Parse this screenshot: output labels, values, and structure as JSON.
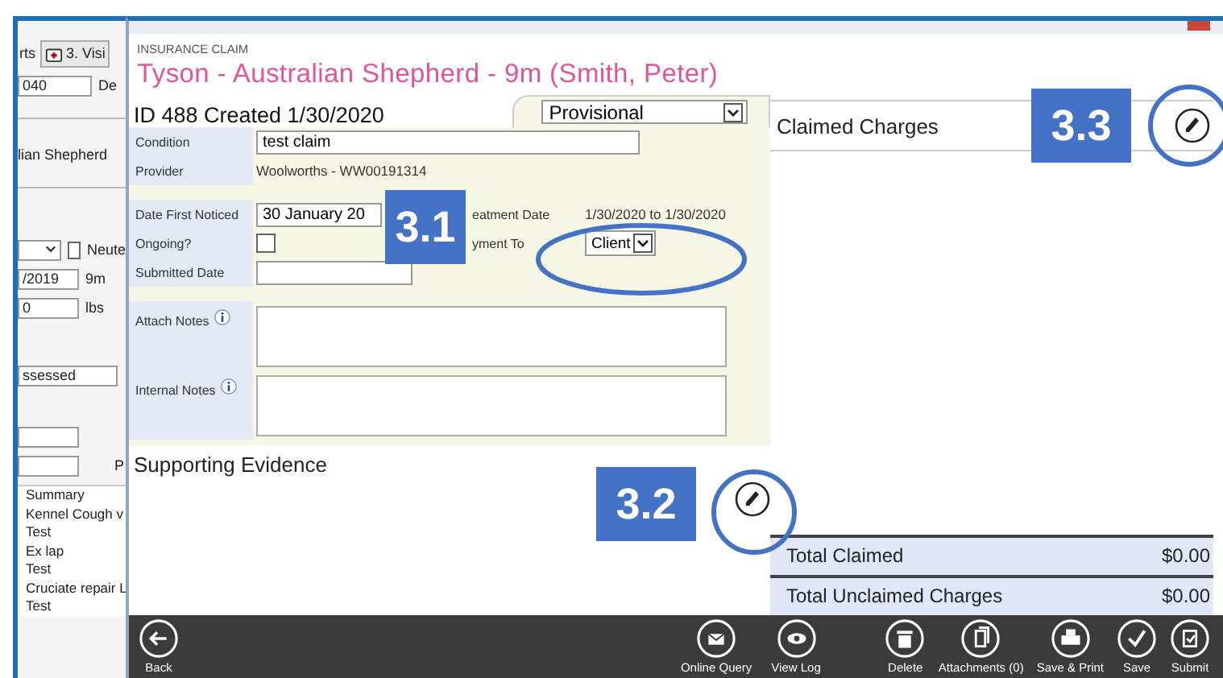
{
  "background_window": {
    "tab_fragment": "rts",
    "visits_tab": "3. Visi",
    "id_fragment": "040",
    "label_fragment": "De",
    "breed": "lian Shepherd",
    "neuter_label": "Neute",
    "neuter_checked": false,
    "dob": "/2019",
    "age": "9m",
    "weight": "0",
    "weight_unit": "lbs",
    "status": "ssessed",
    "p_fragment": "P",
    "history": [
      "Summary",
      "Kennel Cough v",
      "Test",
      "Ex lap",
      "Test",
      "Cruciate repair L",
      "Test"
    ]
  },
  "form_header": "INSURANCE CLAIM",
  "title": "Tyson - Australian Shepherd - 9m (Smith, Peter)",
  "claim_id": "ID 488 Created 1/30/2020",
  "status": "Provisional",
  "condition": {
    "label": "Condition",
    "value": "test claim"
  },
  "provider": {
    "label": "Provider",
    "value": "Woolworths - WW00191314"
  },
  "date_first_noticed": {
    "label": "Date First Noticed",
    "value": "30 January 20"
  },
  "treatment_dates": {
    "label": "eatment Date",
    "value": "1/30/2020 to 1/30/2020"
  },
  "ongoing": {
    "label": "Ongoing?",
    "checked": false
  },
  "payment_to": {
    "label": "yment To",
    "value": "Client"
  },
  "submitted_date": {
    "label": "Submitted Date"
  },
  "attach_notes": {
    "label": "Attach Notes"
  },
  "internal_notes": {
    "label": "Internal Notes"
  },
  "supporting_evidence": "Supporting Evidence",
  "claimed_charges": "Claimed Charges",
  "totals": [
    {
      "label": "Total Claimed",
      "value": "$0.00"
    },
    {
      "label": "Total Unclaimed Charges",
      "value": "$0.00"
    }
  ],
  "toolbar": {
    "back": "Back",
    "groups": [
      [
        {
          "label": "Online Query",
          "kind": "query"
        },
        {
          "label": "View Log",
          "kind": "view"
        }
      ],
      [
        {
          "label": "Delete",
          "kind": "delete"
        },
        {
          "label": "Attachments (0)",
          "kind": "attach"
        },
        {
          "label": "Save & Print",
          "kind": "print"
        },
        {
          "label": "Save",
          "kind": "save"
        },
        {
          "label": "Submit",
          "kind": "submit"
        }
      ]
    ]
  },
  "callouts": [
    {
      "label": "3.1"
    },
    {
      "label": "3.2"
    },
    {
      "label": "3.3"
    }
  ]
}
